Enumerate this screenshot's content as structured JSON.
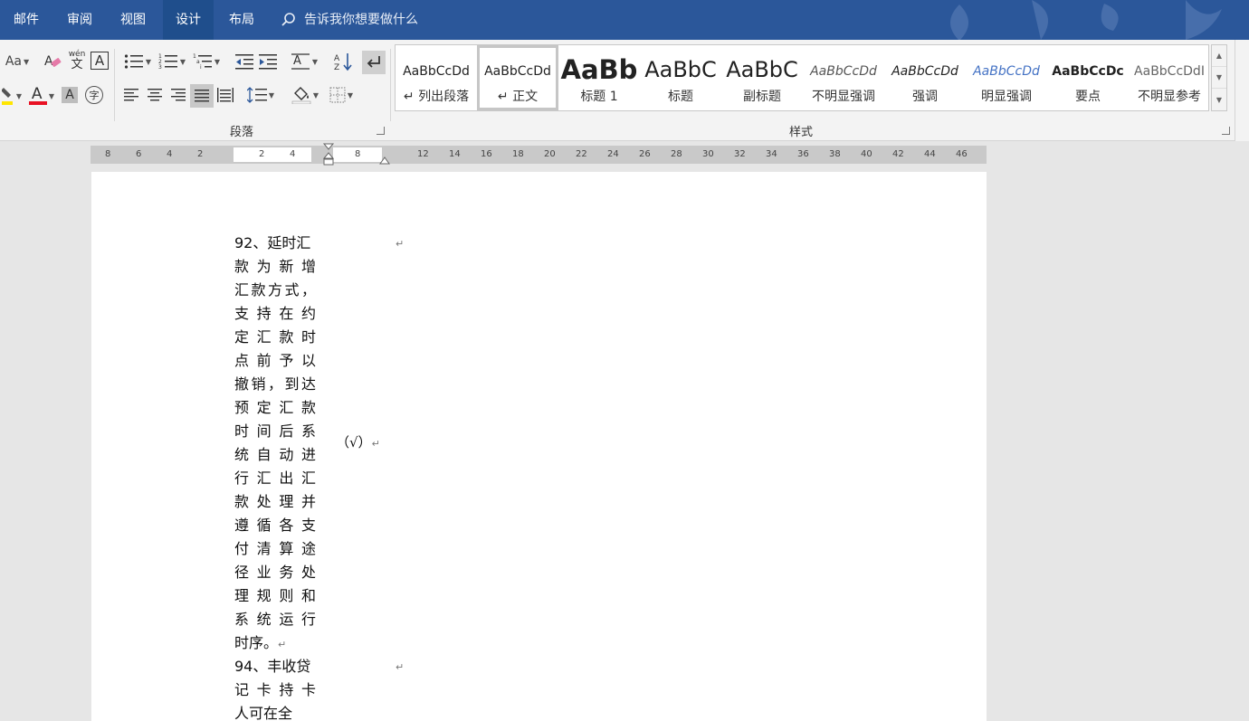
{
  "tabs": [
    {
      "label": "邮件",
      "active": false
    },
    {
      "label": "审阅",
      "active": false
    },
    {
      "label": "视图",
      "active": false
    },
    {
      "label": "设计",
      "active": true
    },
    {
      "label": "布局",
      "active": false
    }
  ],
  "tell_me": {
    "placeholder": "告诉我你想要做什么"
  },
  "font_group": {
    "change_case": "Aa",
    "phonetic_top": "wén",
    "phonetic_bottom": "文",
    "char_border": "A",
    "font_color_glyph": "A",
    "shading_glyph": "A",
    "enclose_glyph": "字",
    "font_color_hex": "#e81123",
    "highlight_hex": "#ffe600"
  },
  "paragraph_group": {
    "label": "段落"
  },
  "styles_group": {
    "label": "样式",
    "items": [
      {
        "sample": "AaBbCcDd",
        "name": "↵ 列出段落",
        "selected": false
      },
      {
        "sample": "AaBbCcDd",
        "name": "↵ 正文",
        "selected": true
      },
      {
        "sample": "AaBb",
        "name": "标题 1",
        "selected": false
      },
      {
        "sample": "AaBbC",
        "name": "标题",
        "selected": false
      },
      {
        "sample": "AaBbC",
        "name": "副标题",
        "selected": false
      },
      {
        "sample": "AaBbCcDd",
        "name": "不明显强调",
        "selected": false
      },
      {
        "sample": "AaBbCcDd",
        "name": "强调",
        "selected": false
      },
      {
        "sample": "AaBbCcDd",
        "name": "明显强调",
        "selected": false
      },
      {
        "sample": "AaBbCcDc",
        "name": "要点",
        "selected": false
      },
      {
        "sample": "AaBbCcDdI",
        "name": "不明显参考",
        "selected": false
      }
    ]
  },
  "ruler": {
    "left_ticks": [
      "8",
      "6",
      "4",
      "2"
    ],
    "cell_ticks": [
      "2",
      "4"
    ],
    "cell2_ticks": [
      "8"
    ],
    "right_ticks": [
      "12",
      "14",
      "16",
      "18",
      "20",
      "22",
      "24",
      "26",
      "28",
      "30",
      "32",
      "34",
      "36",
      "38",
      "40",
      "42",
      "44",
      "46"
    ]
  },
  "document": {
    "item92_lines": [
      "92、延时汇",
      "款为新增",
      "汇款方式，",
      "支持在约",
      "定汇款时",
      "点前予以",
      "撤销，到达",
      "预定汇款",
      "时间后系",
      "统自动进",
      "行汇出汇",
      "款处理并",
      "遵循各支",
      "付清算途",
      "径业务处",
      "理规则和",
      "系统运行",
      "时序。"
    ],
    "item94_lines": [
      "94、丰收贷",
      "记卡持卡",
      "人可在全"
    ],
    "answer": "（√）",
    "para_mark": "↵"
  }
}
